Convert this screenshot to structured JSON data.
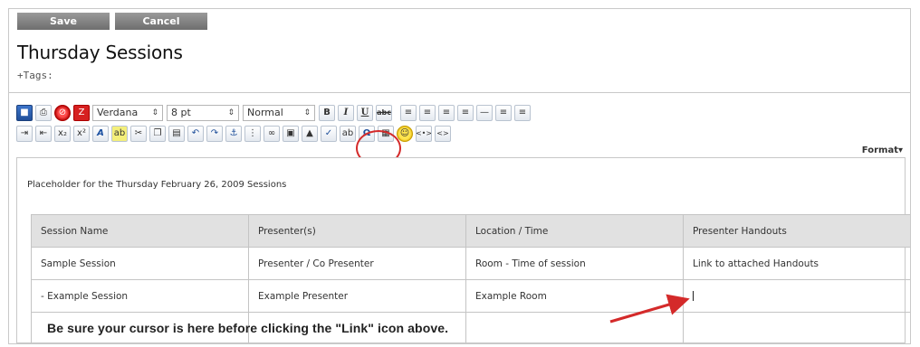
{
  "buttons": {
    "save": "Save",
    "cancel": "Cancel"
  },
  "page": {
    "title": "Thursday Sessions",
    "tags_label": "+Tags:"
  },
  "toolbar": {
    "font_family": "Verdana",
    "font_size": "8 pt",
    "block_format": "Normal",
    "bold": "B",
    "italic": "I",
    "underline": "U",
    "strike": "abc",
    "format_label": "Format▾",
    "icons": [
      "save-icon",
      "print-icon",
      "no-icon",
      "clear-format-icon",
      "bold-icon",
      "italic-icon",
      "underline-icon",
      "strikethrough-icon",
      "align-left-icon",
      "align-center-icon",
      "align-right-icon",
      "align-justify-icon",
      "horizontal-rule-icon",
      "ordered-list-icon",
      "unordered-list-icon",
      "indent-icon",
      "outdent-icon",
      "subscript-icon",
      "superscript-icon",
      "font-color-icon",
      "highlight-icon",
      "cut-icon",
      "copy-icon",
      "paste-icon",
      "undo-icon",
      "redo-icon",
      "anchor-icon",
      "page-break-icon",
      "link-icon",
      "image-icon",
      "picture-icon",
      "spellcheck-icon",
      "replace-icon",
      "special-char-icon",
      "table-icon",
      "smiley-icon",
      "html-tag-icon",
      "source-code-icon"
    ]
  },
  "editor": {
    "placeholder": "Placeholder for the Thursday February 26, 2009 Sessions",
    "table": {
      "headers": [
        "Session Name",
        "Presenter(s)",
        "Location / Time",
        "Presenter Handouts"
      ],
      "rows": [
        [
          "Sample Session",
          "Presenter / Co Presenter",
          "Room - Time of session",
          "Link to attached Handouts"
        ],
        [
          "- Example Session",
          "Example Presenter",
          "Example Room",
          ""
        ],
        [
          "",
          "",
          "",
          ""
        ]
      ]
    },
    "note": "Be sure your cursor is here before clicking the \"Link\" icon above."
  },
  "colors": {
    "annotation_red": "#d42a2a",
    "button_gray": "#7f7f7f",
    "header_gray": "#e1e1e1"
  }
}
